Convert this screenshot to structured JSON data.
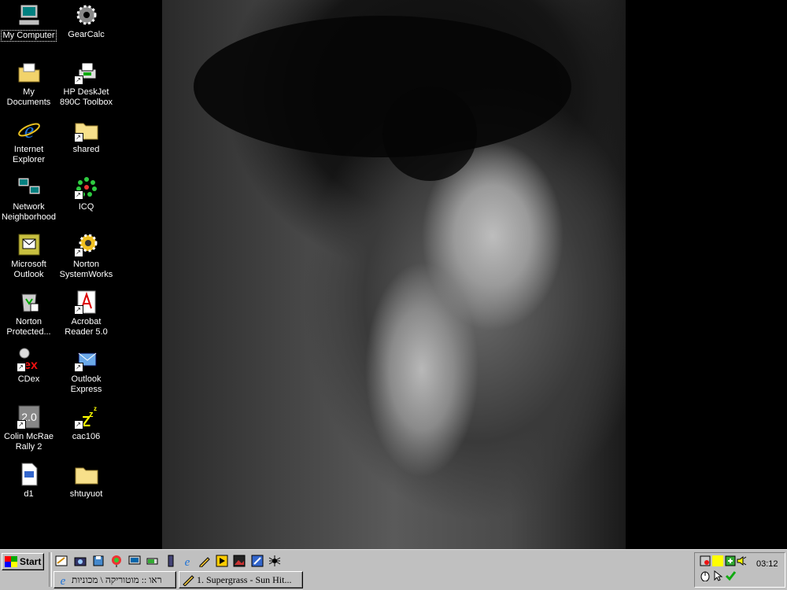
{
  "desktop": {
    "icons": [
      {
        "label": "My Computer",
        "icon": "my-computer-icon",
        "shortcut": false
      },
      {
        "label": "GearCalc",
        "icon": "gearcalc-icon",
        "shortcut": false
      },
      {
        "label": "My Documents",
        "icon": "my-documents-folder-icon",
        "shortcut": false
      },
      {
        "label": "HP DeskJet\n890C Toolbox",
        "icon": "printer-icon",
        "shortcut": true
      },
      {
        "label": "Internet\nExplorer",
        "icon": "internet-explorer-icon",
        "shortcut": false
      },
      {
        "label": "shared",
        "icon": "folder-icon",
        "shortcut": true
      },
      {
        "label": "Network\nNeighborhood",
        "icon": "network-neighborhood-icon",
        "shortcut": false
      },
      {
        "label": "ICQ",
        "icon": "icq-flower-icon",
        "shortcut": true
      },
      {
        "label": "Microsoft\nOutlook",
        "icon": "outlook-icon",
        "shortcut": false
      },
      {
        "label": "Norton\nSystemWorks",
        "icon": "norton-systemworks-icon",
        "shortcut": true
      },
      {
        "label": "Norton\nProtected...",
        "icon": "recycle-bin-icon",
        "shortcut": false
      },
      {
        "label": "Acrobat\nReader 5.0",
        "icon": "acrobat-icon",
        "shortcut": true
      },
      {
        "label": "CDex",
        "icon": "cdex-icon",
        "shortcut": true
      },
      {
        "label": "Outlook\nExpress",
        "icon": "outlook-express-icon",
        "shortcut": true
      },
      {
        "label": "Colin McRae\nRally 2",
        "icon": "rally-icon",
        "shortcut": true
      },
      {
        "label": "cac106",
        "icon": "sleep-zzz-icon",
        "shortcut": true
      },
      {
        "label": "d1",
        "icon": "document-file-icon",
        "shortcut": false
      },
      {
        "label": "shtuyuot",
        "icon": "folder-icon",
        "shortcut": false
      }
    ]
  },
  "taskbar": {
    "start_label": "Start",
    "quick_launch": [
      "show-desktop-icon",
      "camera-icon",
      "disk-icon",
      "balloon-icon",
      "monitor-icon",
      "battery-icon",
      "ie-icon",
      "pencil-icon",
      "media-player-icon",
      "photo-icon",
      "tool-icon",
      "spider-icon"
    ],
    "tasks": [
      {
        "label": "ראו :: מוטוריקה \\ מכוניות",
        "icon": "ie-icon",
        "active": false
      },
      {
        "label": "1. Supergrass - Sun Hit...",
        "icon": "winamp-icon",
        "active": false
      }
    ],
    "tray_icons": [
      "network-icon",
      "yellow-icon",
      "volume-add-icon",
      "speaker-icon",
      "mouse-icon",
      "cursor-icon",
      "green-check-icon"
    ],
    "clock": "03:12"
  },
  "colors": {
    "desktop": "#000000",
    "taskbar": "#c0c0c0",
    "selection": "#000080"
  }
}
